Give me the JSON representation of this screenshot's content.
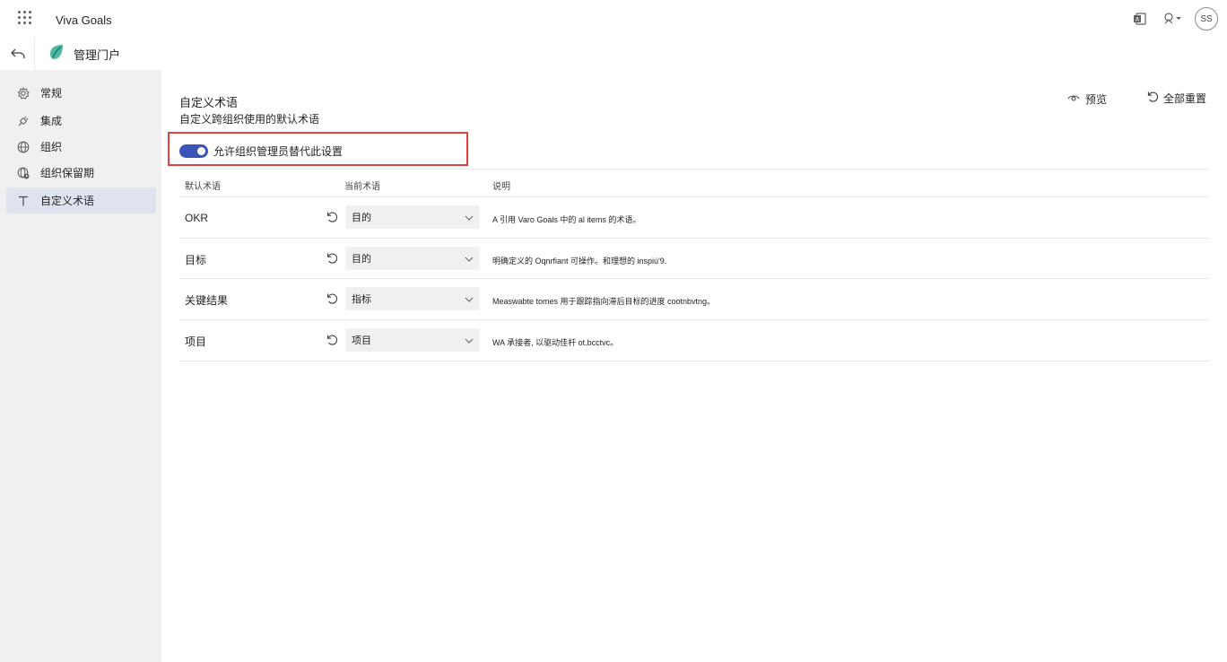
{
  "app": {
    "name": "Viva Goals",
    "avatar_initials": "SS"
  },
  "subbar": {
    "portal_title": "管理门户"
  },
  "sidebar": {
    "items": [
      {
        "label": "常规",
        "icon": "gear-icon"
      },
      {
        "label": "集成",
        "icon": "plug-icon"
      },
      {
        "label": "组织",
        "icon": "globe-icon"
      },
      {
        "label": "组织保留期",
        "icon": "globe-clock-icon"
      },
      {
        "label": "自定义术语",
        "icon": "text-t-icon",
        "active": true
      }
    ]
  },
  "main": {
    "title": "自定义术语",
    "subtitle": "自定义跨组织使用的默认术语",
    "preview_label": "预览",
    "reset_all_label": "全部重置",
    "toggle_label": "允许组织管理员替代此设置",
    "toggle_on": true
  },
  "table": {
    "headers": {
      "default": "默认术语",
      "current": "当前术语",
      "description": "说明"
    },
    "rows": [
      {
        "default": "OKR",
        "current": "目的",
        "description": "A 引用 Varo Goals 中的 al items 的术语。"
      },
      {
        "default": "目标",
        "current": "目的",
        "description": "明确定义的 Oqnrfiant 可操作。和理想的 inspiú'9."
      },
      {
        "default": "关键结果",
        "current": "指标",
        "description": "Measwabte tomes 用于跟踪指向滞后目标的进度 cootnbvtng。"
      },
      {
        "default": "项目",
        "current": "项目",
        "description": "WA 承接者, 以驱动佳杆 ot.bcctvc。"
      }
    ]
  },
  "colors": {
    "accent": "#3b54b8",
    "highlight": "#e0413a",
    "sidebar_bg": "#f0f0f0",
    "active_nav": "#dfe3f0"
  }
}
